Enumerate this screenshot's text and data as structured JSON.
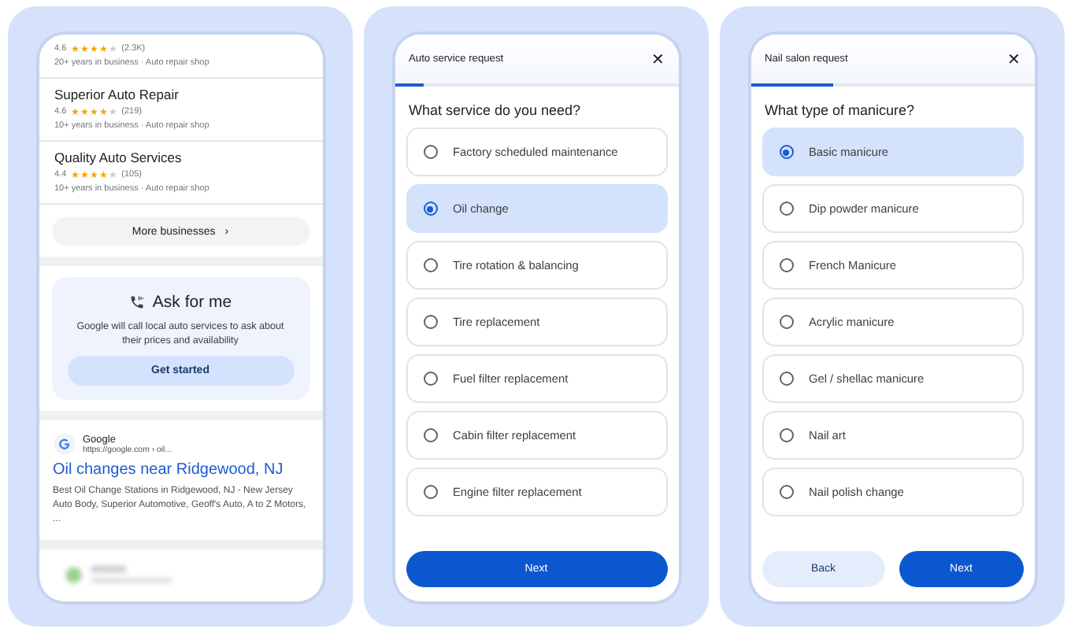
{
  "search_results": {
    "businesses": [
      {
        "rating": "4.6",
        "stars": 4,
        "count": "(2.3K)",
        "meta": "20+ years in business · Auto repair shop"
      },
      {
        "name": "Superior Auto Repair",
        "rating": "4.6",
        "stars": 4,
        "count": "(219)",
        "meta": "10+ years in business · Auto repair shop"
      },
      {
        "name": "Quality Auto Services",
        "rating": "4.4",
        "stars": 4,
        "count": "(105)",
        "meta": "10+ years in business · Auto repair shop"
      }
    ],
    "more_button": "More businesses",
    "more_icon": "›",
    "ask_card": {
      "title": "Ask for me",
      "text": "Google will call local auto services to ask about their prices and availability",
      "button": "Get started"
    },
    "web_result": {
      "site": "Google",
      "url": "https://google.com › oil...",
      "title": "Oil changes near Ridgewood, NJ",
      "snippet": "Best Oil Change Stations in Ridgewood, NJ - New Jersey Auto Body, Superior Automotive, Geoff's Auto, A to Z Motors, ..."
    }
  },
  "forms": [
    {
      "title": "Auto service request",
      "close": "✕",
      "level": 0.1,
      "question": "What service do you need?",
      "options": [
        {
          "label": "Factory scheduled maintenance",
          "selected": false
        },
        {
          "label": "Oil change",
          "selected": true
        },
        {
          "label": "Tire rotation & balancing",
          "selected": false
        },
        {
          "label": "Tire replacement",
          "selected": false
        },
        {
          "label": "Fuel filter replacement",
          "selected": false
        },
        {
          "label": "Cabin filter replacement",
          "selected": false
        },
        {
          "label": "Engine filter replacement",
          "selected": false
        }
      ],
      "buttons": [
        {
          "label": "Next",
          "kind": "primary"
        }
      ]
    },
    {
      "title": "Nail salon request",
      "close": "✕",
      "level": 0.29,
      "question": "What type of manicure?",
      "options": [
        {
          "label": "Basic manicure",
          "selected": true
        },
        {
          "label": "Dip powder manicure",
          "selected": false
        },
        {
          "label": "French Manicure",
          "selected": false
        },
        {
          "label": "Acrylic manicure",
          "selected": false
        },
        {
          "label": "Gel / shellac manicure",
          "selected": false
        },
        {
          "label": "Nail art",
          "selected": false
        },
        {
          "label": "Nail polish change",
          "selected": false
        }
      ],
      "buttons": [
        {
          "label": "Back",
          "kind": "secondary"
        },
        {
          "label": "Next",
          "kind": "primary"
        }
      ]
    }
  ]
}
